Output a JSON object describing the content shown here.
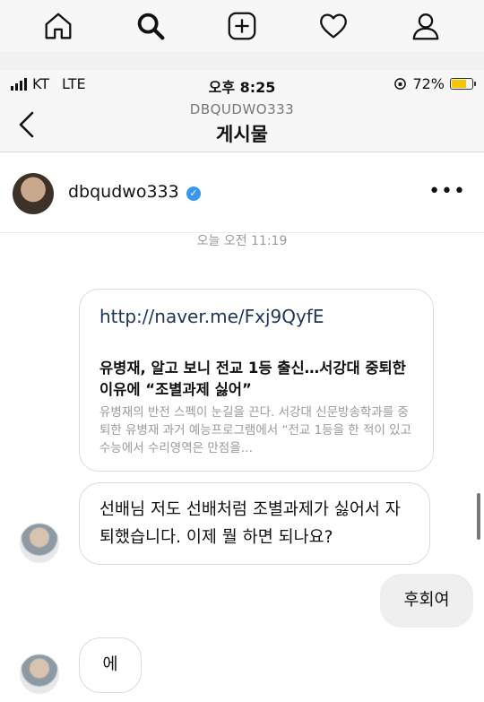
{
  "nav": {
    "items": [
      {
        "icon": "home-icon"
      },
      {
        "icon": "search-icon"
      },
      {
        "icon": "new-post-icon"
      },
      {
        "icon": "heart-icon"
      },
      {
        "icon": "profile-icon"
      }
    ]
  },
  "status": {
    "carrier": "KT",
    "network": "LTE",
    "time": "오후 8:25",
    "battery": "72%",
    "battery_level": 0.72
  },
  "header": {
    "username": "DBQUDWO333",
    "title": "게시물"
  },
  "profile": {
    "name": "dbqudwo333",
    "verified": true
  },
  "timestamp": "오늘 오전 11:19",
  "link_card": {
    "url": "http://naver.me/Fxj9QyfE",
    "headline": "유병재, 알고 보니 전교 1등 출신…서강대 중퇴한 이유에 “조별과제 싫어”",
    "description": "유병재의 반전 스펙이 눈길을 끈다. 서강대 신문방송학과를 중퇴한 유병재 과거 예능프로그램에서 “전교 1등을 한 적이 있고 수능에서 수리영역은 만점을…"
  },
  "messages": [
    {
      "from": "other",
      "text": "선배님 저도 선배처럼 조별과제가 싫어서 자퇴했습니다. 이제 뭘 하면 되나요?"
    },
    {
      "from": "me",
      "text": "후회여"
    },
    {
      "from": "other",
      "text": "에"
    }
  ],
  "colors": {
    "verified": "#3897f0",
    "battery": "#f7c600",
    "bubble_border": "#dbdbdb",
    "my_bubble": "#efefef"
  }
}
